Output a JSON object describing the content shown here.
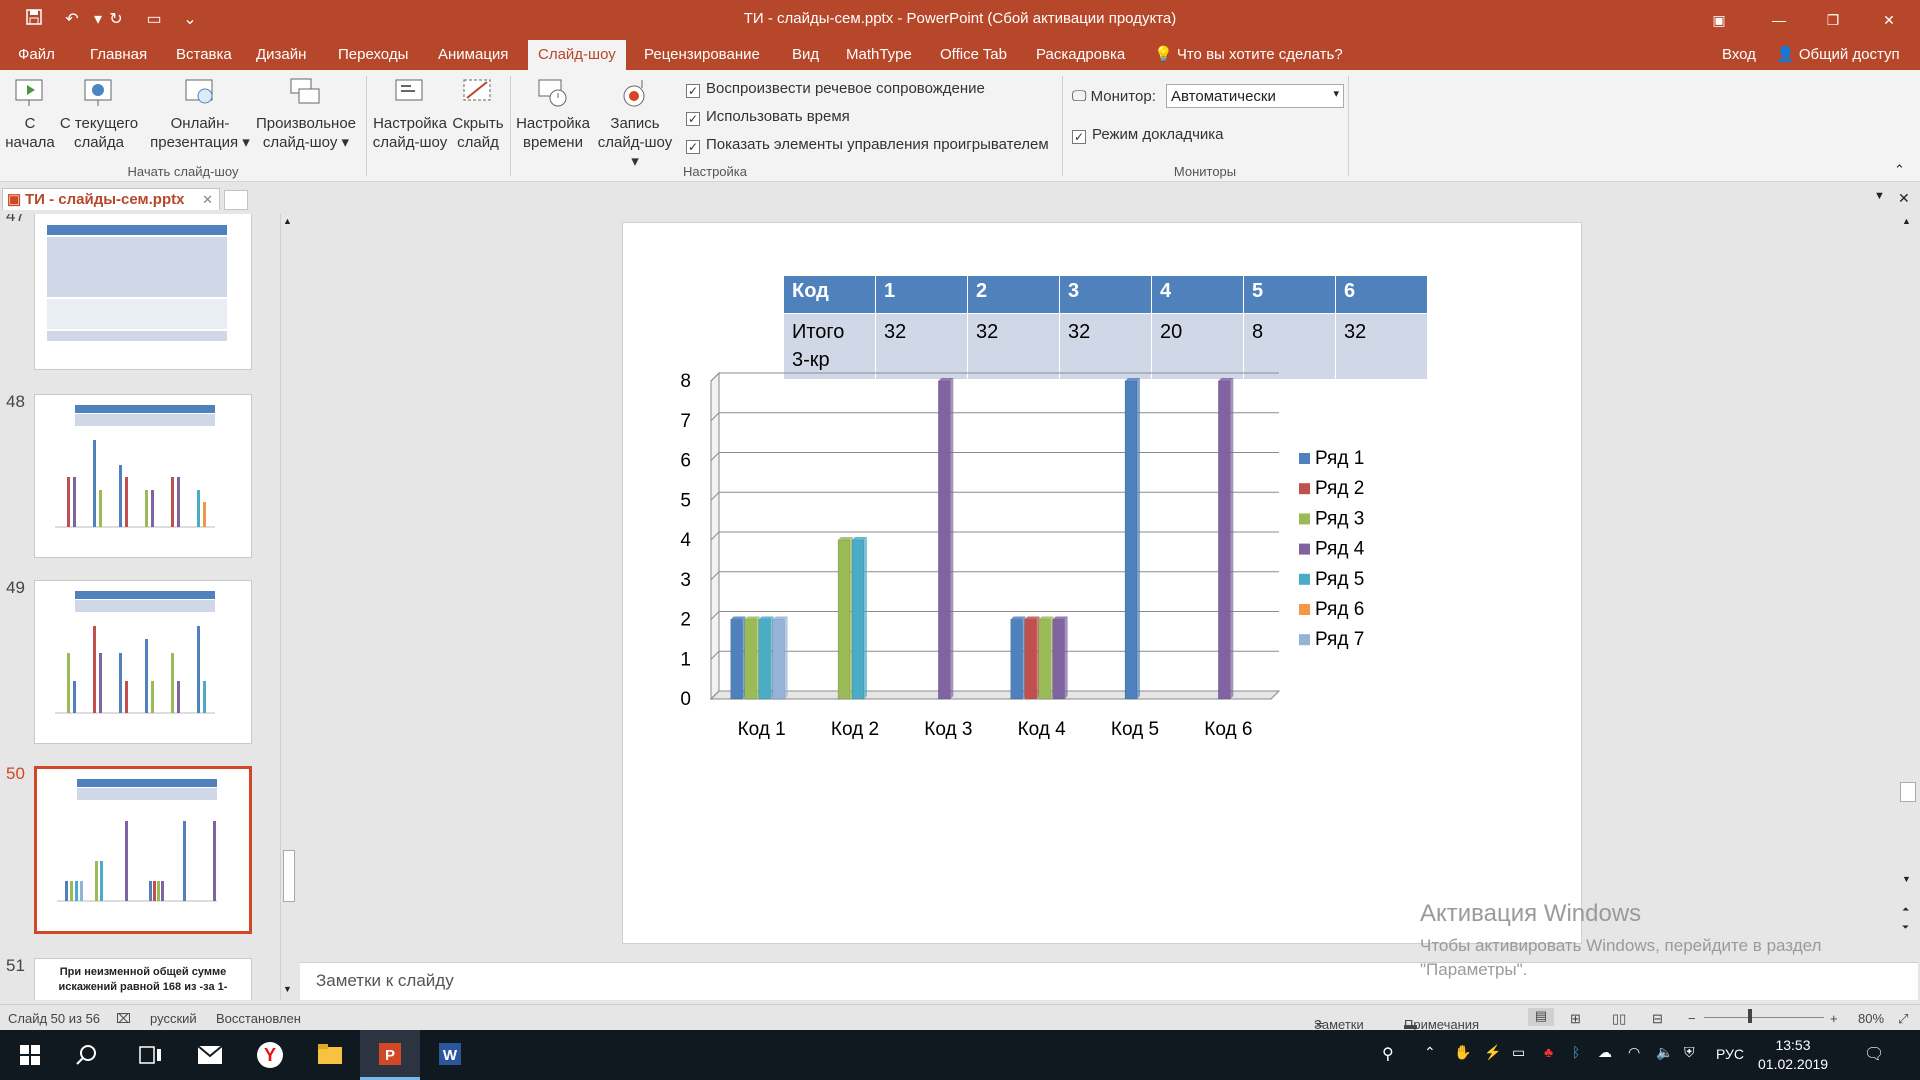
{
  "window": {
    "title": "ТИ - слайды-сем.pptx - PowerPoint (Сбой активации продукта)"
  },
  "tabs": [
    "Файл",
    "Главная",
    "Вставка",
    "Дизайн",
    "Переходы",
    "Анимация",
    "Слайд-шоу",
    "Рецензирование",
    "Вид",
    "MathType",
    "Office Tab",
    "Раскадровка"
  ],
  "tell_me": "Что вы хотите сделать?",
  "sign_in": "Вход",
  "share": "Общий доступ",
  "ribbon": {
    "start_group": {
      "label": "Начать слайд-шоу",
      "buttons": [
        {
          "l1": "С",
          "l2": "начала"
        },
        {
          "l1": "С текущего",
          "l2": "слайда"
        },
        {
          "l1": "Онлайн-",
          "l2": "презентация ▾"
        },
        {
          "l1": "Произвольное",
          "l2": "слайд-шоу ▾"
        }
      ]
    },
    "setup_group": {
      "label": "Настройка",
      "buttons": [
        {
          "l1": "Настройка",
          "l2": "слайд-шоу"
        },
        {
          "l1": "Скрыть",
          "l2": "слайд"
        },
        {
          "l1": "Настройка",
          "l2": "времени"
        },
        {
          "l1": "Запись",
          "l2": "слайд-шоу ▾"
        }
      ],
      "checkboxes": [
        {
          "label": "Воспроизвести речевое сопровождение",
          "checked": true
        },
        {
          "label": "Использовать время",
          "checked": true
        },
        {
          "label": "Показать элементы управления проигрывателем",
          "checked": true
        }
      ]
    },
    "monitors_group": {
      "label": "Мониторы",
      "monitor_label": "Монитор:",
      "monitor_value": "Автоматически",
      "presenter_view": "Режим докладчика"
    }
  },
  "doc_tab": "ТИ - слайды-сем.pptx",
  "thumbnails": [
    {
      "num": "47"
    },
    {
      "num": "48"
    },
    {
      "num": "49"
    },
    {
      "num": "50",
      "selected": true
    },
    {
      "num": "51",
      "text": "При неизменной общей сумме искажений равной 168 из -за 1-"
    }
  ],
  "slide": {
    "table": {
      "header": [
        "Код",
        "1",
        "2",
        "3",
        "4",
        "5",
        "6"
      ],
      "row_label_1": "Итого",
      "row_label_2": "3-кр",
      "row": [
        "32",
        "32",
        "32",
        "20",
        "8",
        "32"
      ]
    }
  },
  "chart_data": {
    "type": "bar",
    "categories": [
      "Код 1",
      "Код 2",
      "Код 3",
      "Код 4",
      "Код 5",
      "Код 6"
    ],
    "ylim": [
      0,
      8
    ],
    "yticks": [
      "0",
      "1",
      "2",
      "3",
      "4",
      "5",
      "6",
      "7",
      "8"
    ],
    "grid": true,
    "legend": "right",
    "series": [
      {
        "name": "Ряд 1",
        "color": "#4f81bd",
        "values": [
          2,
          0,
          0,
          2,
          8,
          0
        ]
      },
      {
        "name": "Ряд 2",
        "color": "#c0504d",
        "values": [
          0,
          0,
          0,
          2,
          0,
          0
        ]
      },
      {
        "name": "Ряд 3",
        "color": "#9bbb59",
        "values": [
          2,
          4,
          0,
          2,
          0,
          0
        ]
      },
      {
        "name": "Ряд 4",
        "color": "#8064a2",
        "values": [
          0,
          0,
          8,
          2,
          0,
          8
        ]
      },
      {
        "name": "Ряд 5",
        "color": "#4bacc6",
        "values": [
          2,
          4,
          0,
          0,
          0,
          0
        ]
      },
      {
        "name": "Ряд 6",
        "color": "#f79646",
        "values": [
          0,
          0,
          0,
          0,
          0,
          0
        ]
      },
      {
        "name": "Ряд 7",
        "color": "#95b3d7",
        "values": [
          2,
          0,
          0,
          0,
          0,
          0
        ]
      }
    ]
  },
  "notes_placeholder": "Заметки к слайду",
  "activation": {
    "title": "Активация Windows",
    "line1": "Чтобы активировать Windows, перейдите в раздел",
    "line2": "\"Параметры\"."
  },
  "status": {
    "slide": "Слайд 50 из 56",
    "language": "русский",
    "recovered": "Восстановлен",
    "notes": "Заметки",
    "comments": "Примечания",
    "zoom": "80%"
  },
  "taskbar": {
    "lang": "РУС",
    "time": "13:53",
    "date": "01.02.2019"
  },
  "colors": {
    "accent": "#b7472a",
    "selection": "#d24726"
  }
}
